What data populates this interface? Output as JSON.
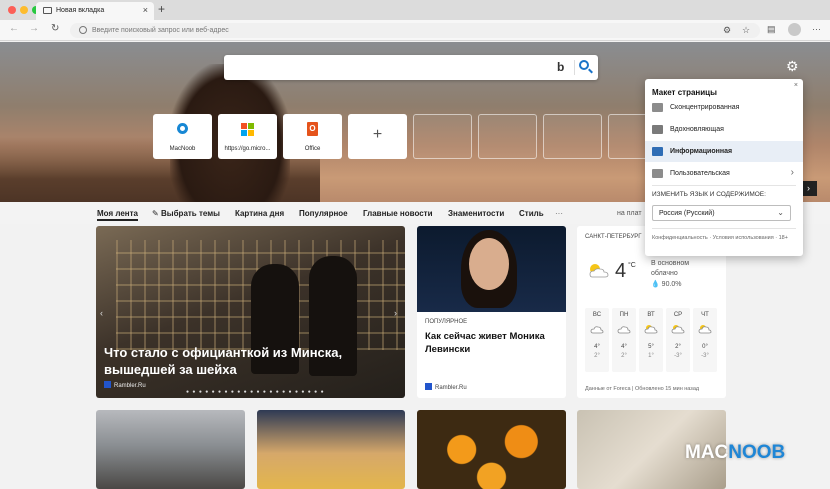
{
  "tab": {
    "title": "Новая вкладка",
    "close": "×",
    "new": "+"
  },
  "address": {
    "placeholder": "Введите поисковый запрос или веб-адрес"
  },
  "search": {
    "bing": "b"
  },
  "tiles": [
    {
      "label": "MacNoob"
    },
    {
      "label": "https://go.micro..."
    },
    {
      "label": "Office"
    }
  ],
  "feed_nav": {
    "items": [
      "Моя лента",
      "Выбрать темы",
      "Картина дня",
      "Популярное",
      "Главные новости",
      "Знаменитости",
      "Стиль",
      "···"
    ],
    "partner": "на плат"
  },
  "big_card": {
    "title": "Что стало с официанткой из Минска, вышедшей за шейха",
    "source": "Rambler.Ru"
  },
  "mid_card": {
    "category": "ПОПУЛЯРНОЕ",
    "title": "Как сейчас живет Моника Левински",
    "source": "Rambler.Ru"
  },
  "weather": {
    "city": "САНКТ-ПЕТЕРБУРГ",
    "temp": "4",
    "unit": "°C",
    "desc_1": "В основном",
    "desc_2": "облачно",
    "rain": "90.0%",
    "days": [
      {
        "name": "ВС",
        "hi": "4°",
        "lo": "2°"
      },
      {
        "name": "ПН",
        "hi": "4°",
        "lo": "2°"
      },
      {
        "name": "ВТ",
        "hi": "5°",
        "lo": "1°"
      },
      {
        "name": "СР",
        "hi": "2°",
        "lo": "-3°"
      },
      {
        "name": "ЧТ",
        "hi": "0°",
        "lo": "-3°"
      }
    ],
    "footer": "Данные от Foreca | Обновлено 15 мин назад"
  },
  "watermark": {
    "mac": "MAC",
    "noob": "NOOB"
  },
  "flyout": {
    "heading": "Макет страницы",
    "close": "×",
    "options": [
      "Сконцентрированная",
      "Вдохновляющая",
      "Информационная",
      "Пользовательская"
    ],
    "lang_label": "ИЗМЕНИТЬ ЯЗЫК И СОДЕРЖИМОЕ:",
    "lang_value": "Россия (Русский)",
    "privacy": "Конфиденциальность · Условия использования · 18+"
  },
  "colors": {
    "accent": "#1a73c8",
    "selected_row": "#e8eef6",
    "watermark_blue": "#1f86d6"
  }
}
